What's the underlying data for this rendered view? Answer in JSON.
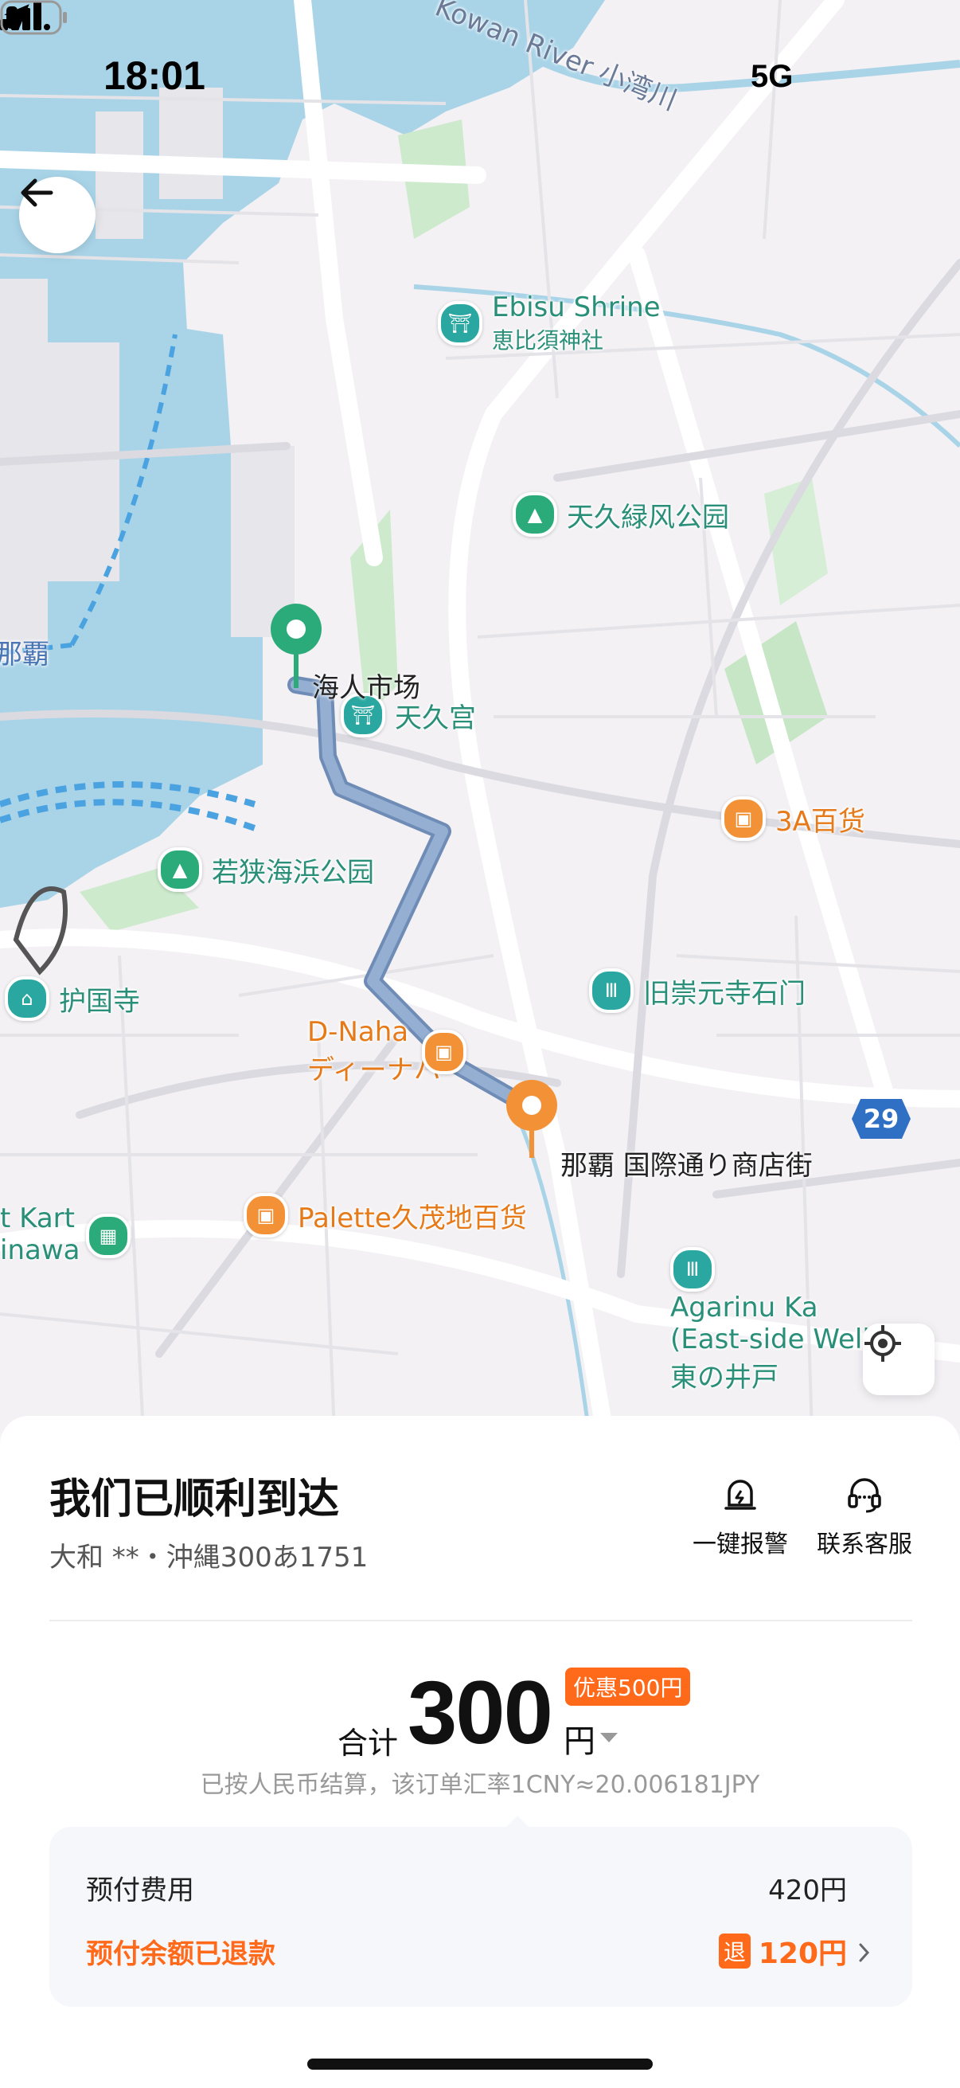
{
  "status_bar": {
    "time": "18:01",
    "network": "5G"
  },
  "map": {
    "river_label": "Kowan River 小湾川",
    "pois": [
      {
        "name": "ebisu",
        "label_en": "Ebisu Shrine",
        "label": "恵比須神社",
        "icon": "shrine-icon"
      },
      {
        "name": "park-tenku",
        "label": "天久緑风公园",
        "icon": "tree-icon"
      },
      {
        "name": "tenku-shrine",
        "label": "天久宫",
        "icon": "shrine-icon"
      },
      {
        "name": "3a",
        "label": "3A百货",
        "icon": "shopping-bag-icon"
      },
      {
        "name": "wakasa-park",
        "label": "若狭海浜公园",
        "icon": "tree-icon"
      },
      {
        "name": "gokokuji",
        "label": "护国寺",
        "icon": "temple-icon"
      },
      {
        "name": "sogenji",
        "label": "旧崇元寺石门",
        "icon": "gate-icon"
      },
      {
        "name": "palette",
        "label": "Palette久茂地百货",
        "icon": "shopping-bag-icon"
      },
      {
        "name": "dnaha",
        "label_en": "D-Naha",
        "label": "ディーナハ",
        "icon": "shopping-bag-icon"
      },
      {
        "name": "agarinu",
        "label_en": "Agarinu Ka (East-side Well)",
        "label": "東の井戸",
        "icon": "well-icon"
      }
    ],
    "pickup_label": "海人市场",
    "dropoff_label": "那覇 国際通り商店街",
    "naha_label": "那覇",
    "route_shield": "29",
    "kart_label": "t Kart\ninawa"
  },
  "sheet": {
    "title": "我们已顺利到达",
    "driver_info": "大和 **・沖縄300あ1751",
    "actions": [
      {
        "label": "一键报警",
        "icon": "alarm-icon"
      },
      {
        "label": "联系客服",
        "icon": "headset-icon"
      }
    ],
    "total_label": "合计",
    "total_amount": "300",
    "total_unit": "円",
    "discount": "优惠500円",
    "rate_text": "已按人民币结算，该订单汇率1CNY≈20.006181JPY",
    "prepay_label": "预付费用",
    "prepay_value": "420円",
    "refund_label": "预付余额已退款",
    "refund_badge": "退",
    "refund_value": "120円"
  },
  "colors": {
    "accent": "#ff6a1a",
    "route": "#8fa9c9",
    "water": "#a9d4e8",
    "park": "#cdeacd",
    "pickup_pin": "#2bab7a",
    "dropoff_pin": "#f39137"
  }
}
